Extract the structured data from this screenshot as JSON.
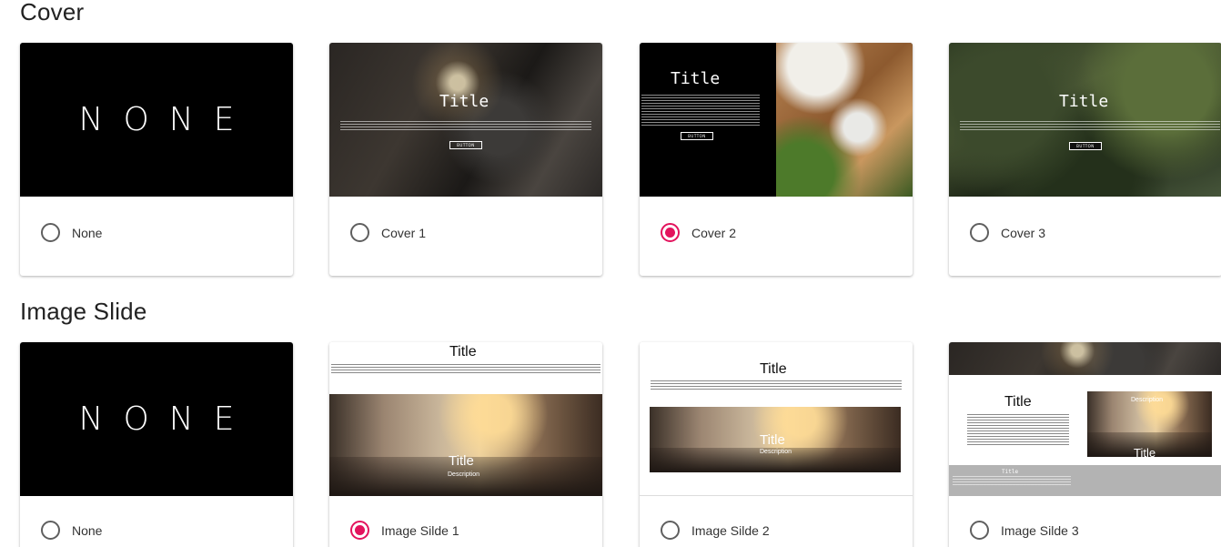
{
  "sections": {
    "cover": {
      "title": "Cover"
    },
    "image_slide": {
      "title": "Image Slide"
    }
  },
  "cover_options": [
    {
      "label": "None",
      "selected": false,
      "thumb_text": "NONE"
    },
    {
      "label": "Cover 1",
      "selected": false,
      "thumb_title": "Title",
      "thumb_button": "BUTTON"
    },
    {
      "label": "Cover 2",
      "selected": true,
      "thumb_title": "Title",
      "thumb_button": "BUTTON"
    },
    {
      "label": "Cover 3",
      "selected": false,
      "thumb_title": "Title",
      "thumb_button": "BUTTON"
    }
  ],
  "slide_options": [
    {
      "label": "None",
      "selected": false,
      "thumb_text": "NONE"
    },
    {
      "label": "Image Silde 1",
      "selected": true,
      "thumb_title": "Title",
      "thumb_inner_title": "Title",
      "thumb_desc": "Description"
    },
    {
      "label": "Image Silde 2",
      "selected": false,
      "thumb_title": "Title",
      "thumb_inner_title": "Title",
      "thumb_desc": "Description"
    },
    {
      "label": "Image Silde 3",
      "selected": false,
      "thumb_title": "Title",
      "thumb_inner_title": "Title",
      "thumb_desc": "Description",
      "thumb_footer_title": "Title"
    }
  ],
  "colors": {
    "accent": "#e3135d",
    "radio_off": "#5f5f5f"
  }
}
